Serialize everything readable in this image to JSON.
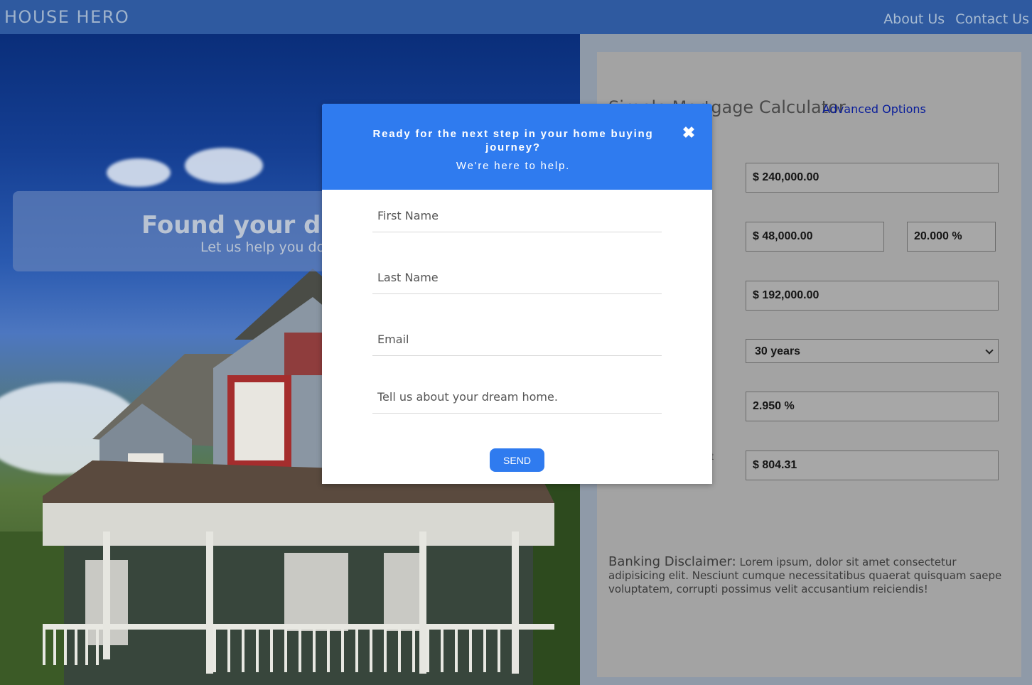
{
  "header": {
    "brand": "HOUSE HERO",
    "nav": [
      "About Us",
      "Contact Us"
    ]
  },
  "hero": {
    "title": "Found your drea",
    "subtitle": "Let us help you do t"
  },
  "calculator": {
    "title": "Simple Mortgage Calculator",
    "advanced_link": "Advanced Options",
    "home_price": "$ 240,000.00",
    "down_payment": "$ 48,000.00",
    "down_percent": "20.000 %",
    "loan_amount": "$ 192,000.00",
    "term": "30 years",
    "rate": "2.950 %",
    "payment_label_fragment": "t",
    "monthly_payment": "$ 804.31",
    "disclaimer_title": "Banking Disclaimer:",
    "disclaimer_text": "Lorem ipsum, dolor sit amet consectetur adipisicing elit. Nesciunt cumque necessitatibus quaerat quisquam saepe voluptatem, corrupti possimus velit accusantium reiciendis!"
  },
  "modal": {
    "question": "Ready for the next step in your home buying journey?",
    "help": "We're here to help.",
    "close_icon": "close-icon",
    "fields": {
      "first_name": "First Name",
      "last_name": "Last Name",
      "email": "Email",
      "message": "Tell us about your dream home."
    },
    "send_label": "SEND"
  },
  "colors": {
    "header_bg": "#2f5aa0",
    "modal_accent": "#2f7bef",
    "link": "#0a1e9a"
  }
}
